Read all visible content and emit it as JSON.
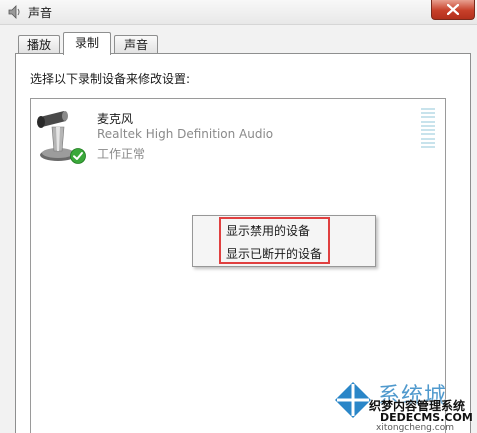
{
  "window": {
    "title": "声音",
    "icon": "speaker-icon",
    "close_icon": "close-icon"
  },
  "tabs": [
    {
      "label": "播放",
      "active": false
    },
    {
      "label": "录制",
      "active": true
    },
    {
      "label": "声音",
      "active": false
    }
  ],
  "recording": {
    "instruction": "选择以下录制设备来修改设置:",
    "device": {
      "name": "麦克风",
      "description": "Realtek High Definition Audio",
      "status": "工作正常",
      "icon": "microphone-icon",
      "badge_icon": "checkmark-badge-icon"
    }
  },
  "context_menu": {
    "items": [
      "显示禁用的设备",
      "显示已断开的设备"
    ],
    "highlight_color": "#e04040"
  },
  "watermark": {
    "brand_big": "系统城",
    "line1": "织梦内容管理系统",
    "line2": "DEDECMS.COM",
    "line3": "xitongcheng.com"
  }
}
